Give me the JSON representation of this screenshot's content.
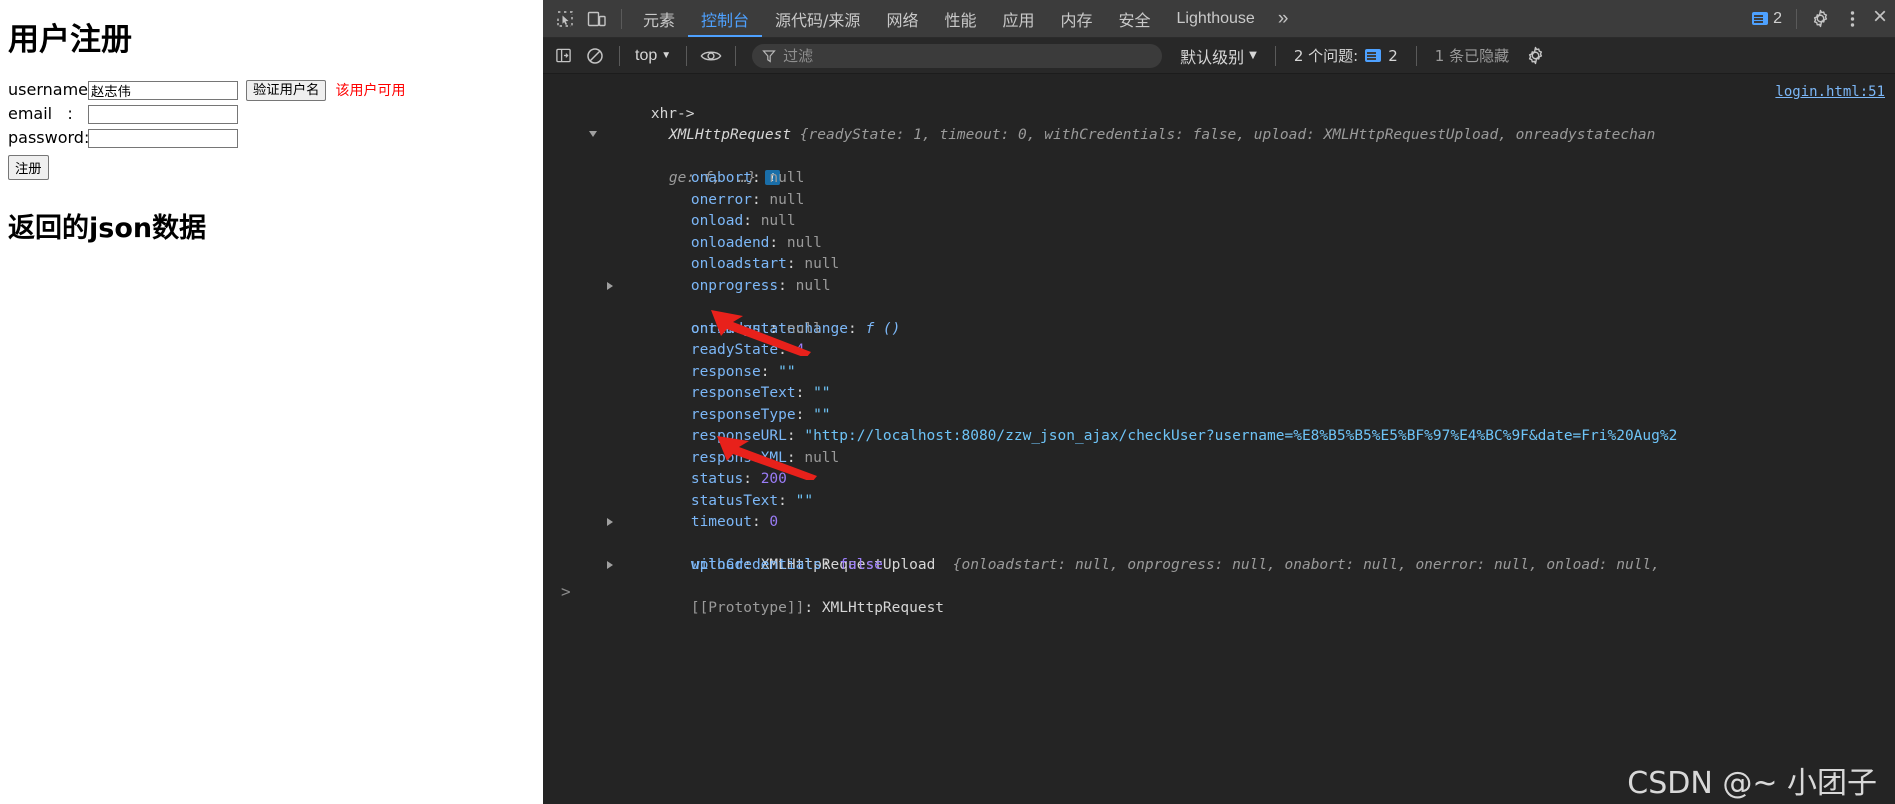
{
  "page": {
    "title": "用户注册",
    "fields": [
      {
        "label": "username:",
        "value": "赵志伟",
        "name": "username"
      },
      {
        "label": "email   :",
        "value": "",
        "name": "email"
      },
      {
        "label": "password:",
        "value": "",
        "name": "password"
      }
    ],
    "verify_button": "验证用户名",
    "hint": "该用户可用",
    "hint_color": "#ff0000",
    "submit_button": "注册",
    "json_heading": "返回的json数据"
  },
  "devtools": {
    "tabs": [
      {
        "label": "元素",
        "active": false
      },
      {
        "label": "控制台",
        "active": true
      },
      {
        "label": "源代码/来源",
        "active": false
      },
      {
        "label": "网络",
        "active": false
      },
      {
        "label": "性能",
        "active": false
      },
      {
        "label": "应用",
        "active": false
      },
      {
        "label": "内存",
        "active": false
      },
      {
        "label": "安全",
        "active": false
      },
      {
        "label": "Lighthouse",
        "active": false
      }
    ],
    "more_tabs": "»",
    "issue_count": "2",
    "close_label": "×",
    "filterbar": {
      "context": "top",
      "filter_placeholder": "过滤",
      "level": "默认级别",
      "issues_label": "2 个问题:",
      "issues_count": "2",
      "hidden_label": "1 条已隐藏"
    },
    "accent_color": "#4ea1ff"
  },
  "console": {
    "source_link": "login.html:51",
    "prompt": ">",
    "lines": [
      {
        "kind": "log",
        "text": "xhr->"
      },
      {
        "kind": "object-head",
        "class": "XMLHttpRequest",
        "preview": "{readyState: 1, timeout: 0, withCredentials: false, upload: XMLHttpRequestUpload, onreadystatechan"
      },
      {
        "kind": "object-head-cont",
        "preview": "ge: f,  …}",
        "badge": "i"
      },
      {
        "kind": "prop",
        "name": "onabort",
        "value": "null",
        "type": "null"
      },
      {
        "kind": "prop",
        "name": "onerror",
        "value": "null",
        "type": "null"
      },
      {
        "kind": "prop",
        "name": "onload",
        "value": "null",
        "type": "null"
      },
      {
        "kind": "prop",
        "name": "onloadend",
        "value": "null",
        "type": "null"
      },
      {
        "kind": "prop",
        "name": "onloadstart",
        "value": "null",
        "type": "null"
      },
      {
        "kind": "prop",
        "name": "onprogress",
        "value": "null",
        "type": "null"
      },
      {
        "kind": "prop-expandable",
        "name": "onreadystatechange",
        "value": "f ()",
        "type": "fn"
      },
      {
        "kind": "prop",
        "name": "ontimeout",
        "value": "null",
        "type": "null"
      },
      {
        "kind": "prop",
        "name": "readyState",
        "value": "4",
        "type": "num"
      },
      {
        "kind": "prop",
        "name": "response",
        "value": "\"\"",
        "type": "str"
      },
      {
        "kind": "prop",
        "name": "responseText",
        "value": "\"\"",
        "type": "str"
      },
      {
        "kind": "prop",
        "name": "responseType",
        "value": "\"\"",
        "type": "str"
      },
      {
        "kind": "prop",
        "name": "responseURL",
        "value": "\"http://localhost:8080/zzw_json_ajax/checkUser?username=%E8%B5%B5%E5%BF%97%E4%BC%9F&date=Fri%20Aug%2",
        "type": "str"
      },
      {
        "kind": "prop",
        "name": "responseXML",
        "value": "null",
        "type": "null"
      },
      {
        "kind": "prop",
        "name": "status",
        "value": "200",
        "type": "num"
      },
      {
        "kind": "prop",
        "name": "statusText",
        "value": "\"\"",
        "type": "str"
      },
      {
        "kind": "prop",
        "name": "timeout",
        "value": "0",
        "type": "num"
      },
      {
        "kind": "prop-expandable-obj",
        "name": "upload",
        "class": "XMLHttpRequestUpload",
        "preview": "{onloadstart: null, onprogress: null, onabort: null, onerror: null, onload: null,"
      },
      {
        "kind": "prop",
        "name": "withCredentials",
        "value": "false",
        "type": "bool"
      },
      {
        "kind": "prop-expandable-proto",
        "name": "[[Prototype]]",
        "value": "XMLHttpRequest",
        "type": "plain"
      }
    ]
  },
  "watermark": "CSDN @~ 小团子"
}
